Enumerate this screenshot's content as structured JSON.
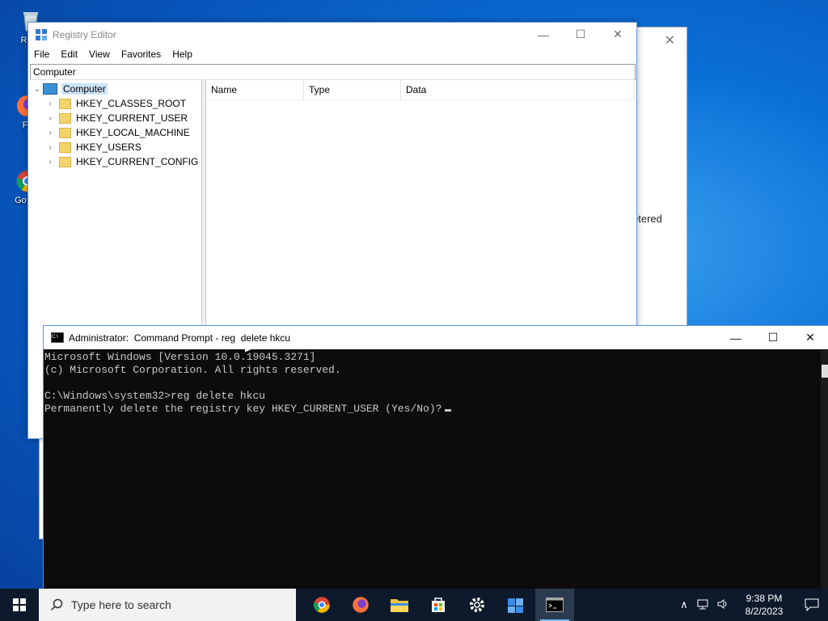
{
  "desktop": {
    "icons": [
      {
        "label": "Recy"
      },
      {
        "label": "Fir"
      },
      {
        "label": "Go Ch"
      }
    ]
  },
  "background_window": {
    "close_glyph": "✕",
    "text_fragment": "etered"
  },
  "regedit": {
    "title": "Registry Editor",
    "menu": [
      "File",
      "Edit",
      "View",
      "Favorites",
      "Help"
    ],
    "address": "Computer",
    "tree": {
      "root": "Computer",
      "keys": [
        "HKEY_CLASSES_ROOT",
        "HKEY_CURRENT_USER",
        "HKEY_LOCAL_MACHINE",
        "HKEY_USERS",
        "HKEY_CURRENT_CONFIG"
      ]
    },
    "columns": [
      "Name",
      "Type",
      "Data"
    ]
  },
  "cmd": {
    "title": "Administrator:  Command Prompt - reg  delete hkcu",
    "lines": [
      "Microsoft Windows [Version 10.0.19045.3271]",
      "(c) Microsoft Corporation. All rights reserved.",
      "",
      "C:\\Windows\\system32>reg delete hkcu",
      "Permanently delete the registry key HKEY_CURRENT_USER (Yes/No)?"
    ]
  },
  "taskbar": {
    "search_placeholder": "Type here to search",
    "apps": [
      {
        "name": "chrome-icon",
        "color": "#db4437"
      },
      {
        "name": "firefox-icon",
        "color": "#ff7139"
      },
      {
        "name": "file-explorer-icon",
        "color": "#f3c13a"
      },
      {
        "name": "store-icon",
        "color": "#ffffff"
      },
      {
        "name": "settings-icon",
        "color": "#ffffff"
      },
      {
        "name": "regedit-icon",
        "color": "#3a8ee6"
      },
      {
        "name": "cmd-icon",
        "color": "#000000"
      }
    ],
    "time": "9:38 PM",
    "date": "8/2/2023"
  }
}
